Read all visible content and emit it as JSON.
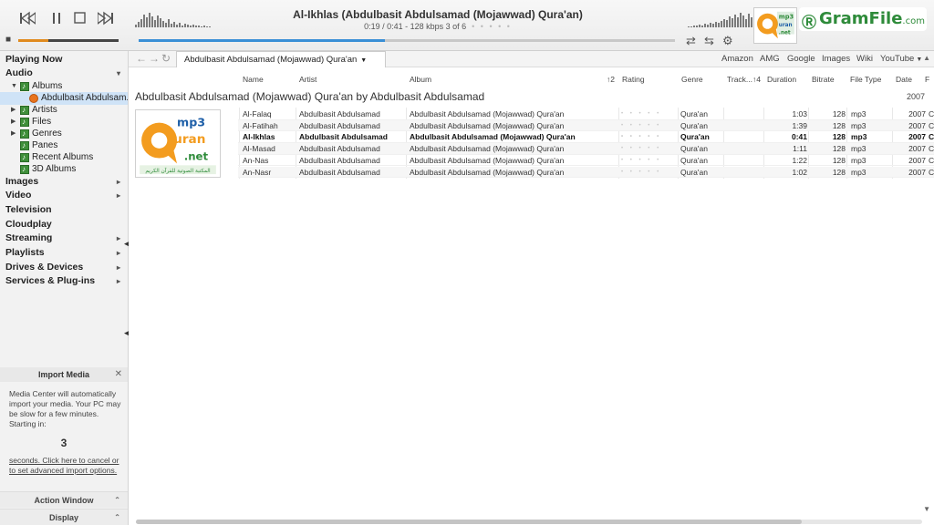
{
  "player": {
    "now_playing_title": "Al-Ikhlas (Abdulbasit Abdulsamad (Mojawwad) Qura'an)",
    "time_info": "0:19 / 0:41 -  128 kbps   3 of 6",
    "position_dots": "• • • • •",
    "seek_progress": 0.46,
    "volume_level": 0.3,
    "icons": {
      "previous": "skip-previous-icon",
      "pause": "pause-icon",
      "stop": "stop-icon",
      "next": "skip-next-icon",
      "volume": "speaker-icon",
      "repeat": "repeat-icon",
      "shuffle": "shuffle-icon",
      "settings": "gear-icon"
    }
  },
  "watermark": {
    "text": "GramFile",
    "suffix": ".com"
  },
  "tree": {
    "categories": [
      {
        "label": "Playing Now",
        "arrow": ""
      },
      {
        "label": "Audio",
        "arrow": "▾"
      },
      {
        "label": "Images",
        "arrow": "▸"
      },
      {
        "label": "Video",
        "arrow": "▸"
      },
      {
        "label": "Television",
        "arrow": ""
      },
      {
        "label": "Cloudplay",
        "arrow": ""
      },
      {
        "label": "Streaming",
        "arrow": "▸"
      },
      {
        "label": "Playlists",
        "arrow": "▸"
      },
      {
        "label": "Drives & Devices",
        "arrow": "▸"
      },
      {
        "label": "Services & Plug-ins",
        "arrow": "▸"
      }
    ],
    "audio_children": [
      {
        "label": "Albums"
      },
      {
        "label": "Abdulbasit Abdulsam..."
      },
      {
        "label": "Artists"
      },
      {
        "label": "Files"
      },
      {
        "label": "Genres"
      },
      {
        "label": "Panes"
      },
      {
        "label": "Recent Albums"
      },
      {
        "label": "3D Albums"
      }
    ]
  },
  "import_media": {
    "title": "Import Media",
    "message": "Media Center will automatically import your media.  Your PC may be slow for a few minutes. Starting in:",
    "countdown": "3",
    "link": "seconds.  Click here to cancel or to set advanced import options."
  },
  "bottom_sections": {
    "action_window": "Action Window",
    "display": "Display"
  },
  "view": {
    "tab_label": "Abdulbasit Abdulsamad (Mojawwad) Qura'an",
    "external_links": [
      "Amazon",
      "AMG",
      "Google",
      "Images",
      "Wiki",
      "YouTube"
    ]
  },
  "columns": {
    "name": "Name",
    "artist": "Artist",
    "album": "Album",
    "sort_album": "↑2",
    "rating": "Rating",
    "genre": "Genre",
    "track": "Track...",
    "sort_track": "↑4",
    "duration": "Duration",
    "bitrate": "Bitrate",
    "file_type": "File Type",
    "date": "Date",
    "extra": "F"
  },
  "group": {
    "title": "Abdulbasit Abdulsamad (Mojawwad) Qura'an by Abdulbasit Abdulsamad",
    "date": "2007"
  },
  "tracks": [
    {
      "name": "Al-Falaq",
      "artist": "Abdulbasit Abdulsamad",
      "album": "Abdulbasit Abdulsamad (Mojawwad) Qura'an",
      "rating": "• • • • •",
      "genre": "Qura'an",
      "duration": "1:03",
      "bitrate": "128",
      "file_type": "mp3",
      "date": "2007",
      "extra": "C"
    },
    {
      "name": "Al-Fatihah",
      "artist": "Abdulbasit Abdulsamad",
      "album": "Abdulbasit Abdulsamad (Mojawwad) Qura'an",
      "rating": "• • • • •",
      "genre": "Qura'an",
      "duration": "1:39",
      "bitrate": "128",
      "file_type": "mp3",
      "date": "2007",
      "extra": "C"
    },
    {
      "name": "Al-Ikhlas",
      "artist": "Abdulbasit Abdulsamad",
      "album": "Abdulbasit Abdulsamad (Mojawwad) Qura'an",
      "rating": "• • • • •",
      "genre": "Qura'an",
      "duration": "0:41",
      "bitrate": "128",
      "file_type": "mp3",
      "date": "2007",
      "extra": "C"
    },
    {
      "name": "Al-Masad",
      "artist": "Abdulbasit Abdulsamad",
      "album": "Abdulbasit Abdulsamad (Mojawwad) Qura'an",
      "rating": "• • • • •",
      "genre": "Qura'an",
      "duration": "1:11",
      "bitrate": "128",
      "file_type": "mp3",
      "date": "2007",
      "extra": "C"
    },
    {
      "name": "An-Nas",
      "artist": "Abdulbasit Abdulsamad",
      "album": "Abdulbasit Abdulsamad (Mojawwad) Qura'an",
      "rating": "• • • • •",
      "genre": "Qura'an",
      "duration": "1:22",
      "bitrate": "128",
      "file_type": "mp3",
      "date": "2007",
      "extra": "C"
    },
    {
      "name": "An-Nasr",
      "artist": "Abdulbasit Abdulsamad",
      "album": "Abdulbasit Abdulsamad (Mojawwad) Qura'an",
      "rating": "• • • • •",
      "genre": "Qura'an",
      "duration": "1:02",
      "bitrate": "128",
      "file_type": "mp3",
      "date": "2007",
      "extra": "C"
    }
  ],
  "album_art": {
    "line1": "mp3",
    "line2": "uran",
    "line3": ".net",
    "arabic_caption": "المكتبة الصوتية للقرآن الكريم"
  },
  "colors": {
    "accent_blue": "#3a8fd6",
    "accent_orange": "#e08a1e",
    "logo_green": "#2e8b3a",
    "logo_orange": "#f39c1f"
  }
}
